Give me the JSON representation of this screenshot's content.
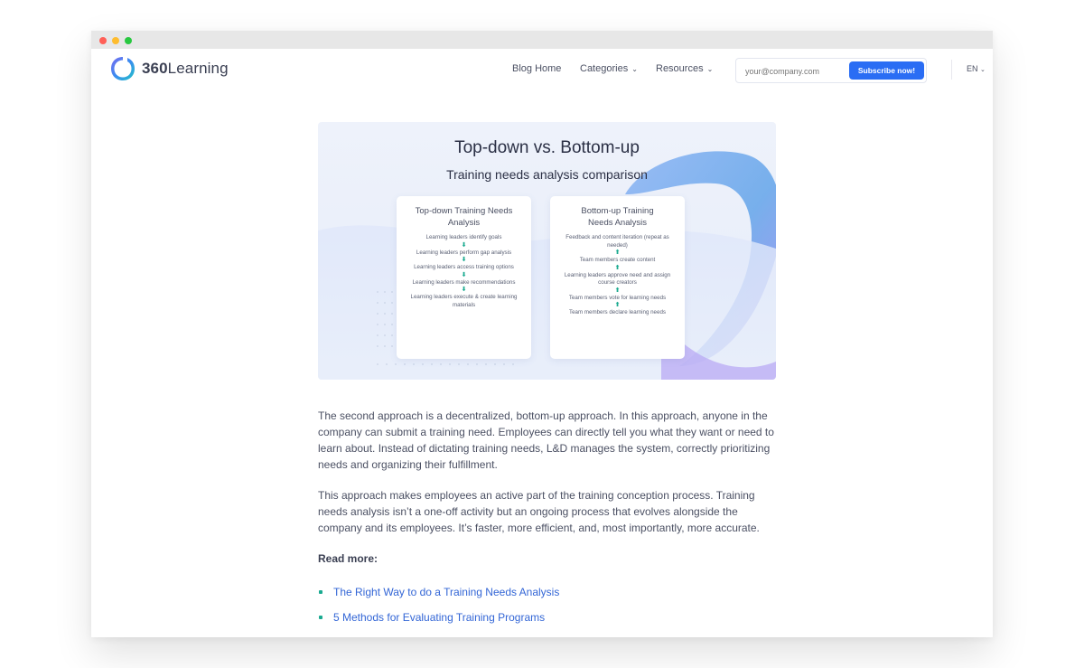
{
  "browser": {
    "controls": [
      "close",
      "minimize",
      "maximize"
    ]
  },
  "brand": {
    "name_bold": "360",
    "name_rest": "Learning",
    "logo_icon": "360learning-ring-logo",
    "accent": "#2a6df4"
  },
  "nav": {
    "blog_home": "Blog Home",
    "categories": "Categories",
    "resources": "Resources",
    "subscribe_placeholder": "your@company.com",
    "subscribe_button": "Subscribe now!",
    "language": "EN"
  },
  "hero": {
    "title": "Top-down vs. Bottom-up",
    "subtitle": "Training needs analysis comparison",
    "top_down": {
      "title": "Top-down Training Needs Analysis",
      "steps": [
        "Learning leaders identify goals",
        "Learning leaders perform gap analysis",
        "Learning leaders access training options",
        "Learning leaders make recommendations",
        "Learning leaders execute & create learning materials"
      ],
      "arrow": "⬇"
    },
    "bottom_up": {
      "title": "Bottom-up Training Needs Analysis",
      "steps": [
        "Feedback and content iteration (repeat as needed)",
        "Team members create content",
        "Learning leaders approve need and assign course creators",
        "Team members vote for learning needs",
        "Team members declare learning needs"
      ],
      "arrow": "⬆"
    }
  },
  "article": {
    "p1": "The second approach is a decentralized, bottom-up approach. In this approach, anyone in the company can submit a training need. Employees can directly tell you what they want or need to learn about. Instead of dictating training needs, L&D manages the system, correctly prioritizing needs and organizing their fulfillment.",
    "p2": "This approach makes employees an active part of the training conception process. Training needs analysis isn’t a one-off activity but an ongoing process that evolves alongside the company and its employees. It’s faster, more efficient, and, most importantly, more accurate.",
    "read_more": "Read more:",
    "links": [
      "The Right Way to do a Training Needs Analysis",
      "5 Methods for Evaluating Training Programs"
    ]
  }
}
